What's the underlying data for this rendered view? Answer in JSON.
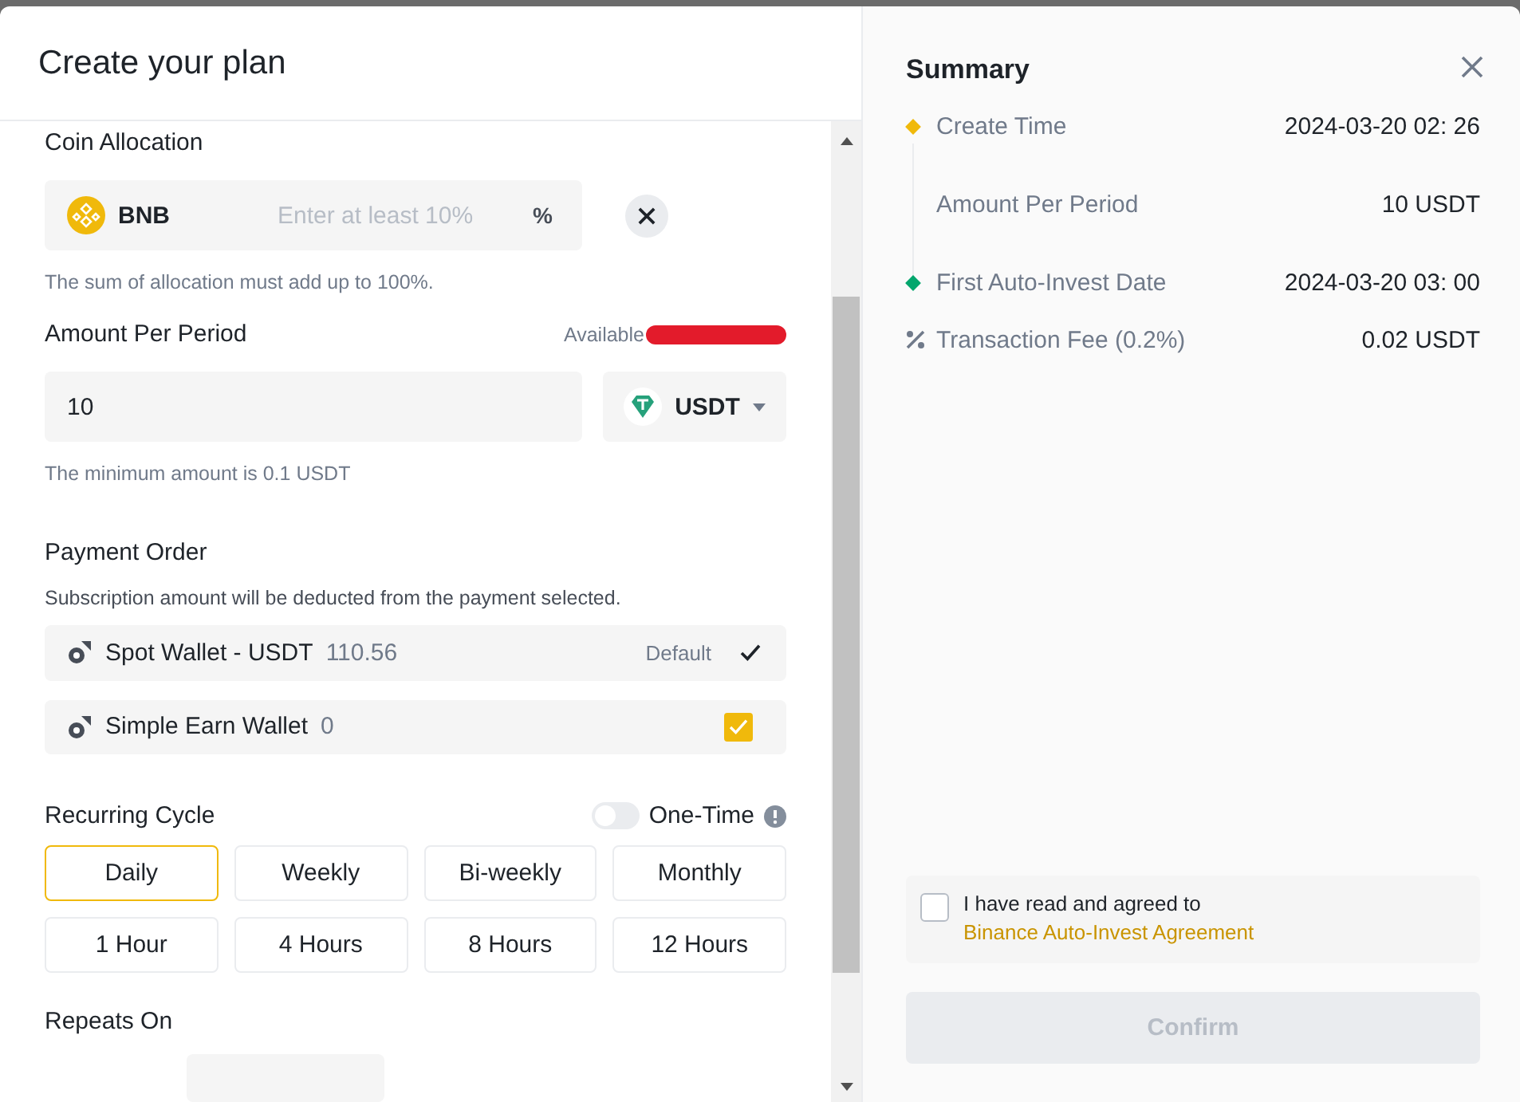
{
  "dialog": {
    "title": "Create your plan"
  },
  "coin_allocation": {
    "label": "Coin Allocation",
    "coin": "BNB",
    "placeholder": "Enter at least 10%",
    "unit": "%",
    "hint": "The sum of allocation must add up to 100%."
  },
  "amount": {
    "label": "Amount Per Period",
    "available_label": "Available",
    "value": "10",
    "currency": "USDT",
    "hint": "The minimum amount is 0.1 USDT"
  },
  "payment_order": {
    "label": "Payment Order",
    "description": "Subscription amount will be deducted from the payment selected.",
    "wallets": [
      {
        "name": "Spot Wallet - USDT",
        "balance": "110.56",
        "badge": "Default",
        "kind": "tick",
        "checked": true
      },
      {
        "name": "Simple Earn Wallet",
        "balance": "0",
        "kind": "checkbox",
        "checked": true
      }
    ]
  },
  "recurring_cycle": {
    "label": "Recurring Cycle",
    "one_time": {
      "label": "One-Time",
      "on": false
    },
    "options": [
      {
        "label": "Daily",
        "selected": true
      },
      {
        "label": "Weekly",
        "selected": false
      },
      {
        "label": "Bi-weekly",
        "selected": false
      },
      {
        "label": "Monthly",
        "selected": false
      },
      {
        "label": "1 Hour",
        "selected": false
      },
      {
        "label": "4 Hours",
        "selected": false
      },
      {
        "label": "8 Hours",
        "selected": false
      },
      {
        "label": "12 Hours",
        "selected": false
      }
    ]
  },
  "repeats_on": {
    "label": "Repeats On"
  },
  "summary": {
    "title": "Summary",
    "rows": [
      {
        "label": "Create Time",
        "value": "2024-03-20 02: 26",
        "kind": "start"
      },
      {
        "label": "Amount Per Period",
        "value": "10 USDT",
        "kind": "middle"
      },
      {
        "label": "First Auto-Invest Date",
        "value": "2024-03-20 03: 00",
        "kind": "end"
      },
      {
        "label": "Transaction Fee (0.2%)",
        "value": "0.02 USDT",
        "kind": "fee"
      }
    ],
    "agreement": {
      "text": "I have read and agreed to ",
      "link": "Binance Auto-Invest Agreement",
      "checked": false
    },
    "confirm": {
      "label": "Confirm",
      "disabled": true
    }
  }
}
